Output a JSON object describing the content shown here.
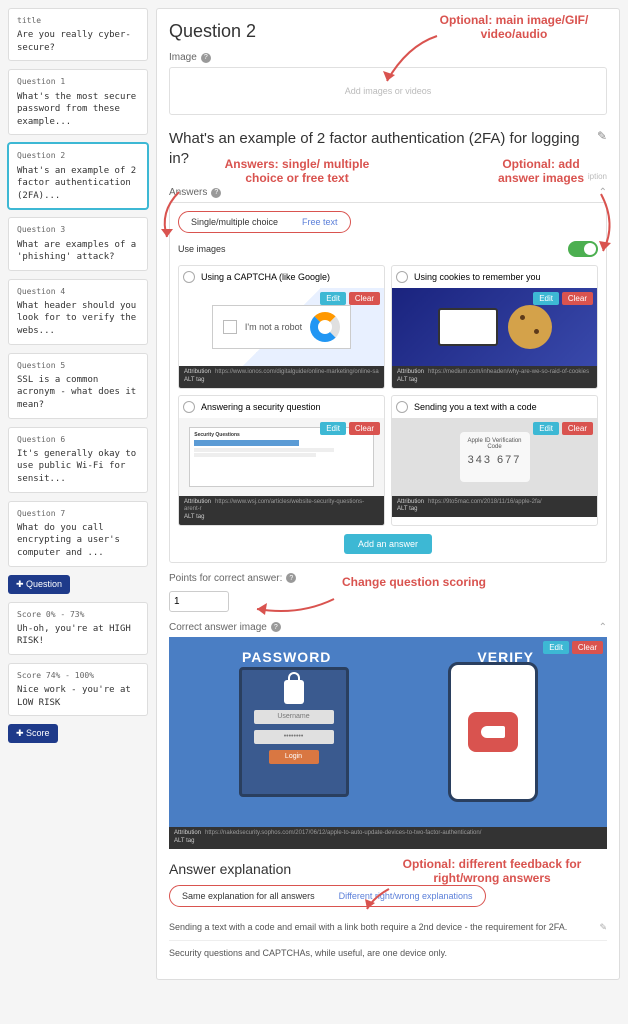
{
  "sidebar": {
    "title_card": {
      "label": "title",
      "text": "Are you really cyber-secure?"
    },
    "questions": [
      {
        "label": "Question 1",
        "text": "What's the most secure password from these example..."
      },
      {
        "label": "Question 2",
        "text": "What's an example of 2 factor authentication (2FA)..."
      },
      {
        "label": "Question 3",
        "text": "What are examples of a 'phishing' attack?"
      },
      {
        "label": "Question 4",
        "text": "What header should you look for to verify the webs..."
      },
      {
        "label": "Question 5",
        "text": "SSL is a common acronym - what does it mean?"
      },
      {
        "label": "Question 6",
        "text": "It's generally okay to use public Wi-Fi for sensit..."
      },
      {
        "label": "Question 7",
        "text": "What do you call encrypting a user's computer and ..."
      }
    ],
    "add_question_btn": "✚ Question",
    "scores": [
      {
        "label": "Score 0% - 73%",
        "text": "Uh-oh, you're at HIGH RISK!"
      },
      {
        "label": "Score 74% - 100%",
        "text": "Nice work - you're at LOW RISK"
      }
    ],
    "add_score_btn": "✚ Score"
  },
  "main": {
    "question_title": "Question 2",
    "image_label": "Image",
    "media_placeholder": "Add images or videos",
    "question_text": "What's an example of 2 factor authentication (2FA) for logging in?",
    "description_hint": "iption",
    "answers_label": "Answers",
    "tabs": {
      "choice": "Single/multiple choice",
      "free": "Free text"
    },
    "use_images_label": "Use images",
    "answers": [
      {
        "text": "Using a CAPTCHA (like Google)",
        "captcha_text": "I'm not a robot",
        "attribution": "https://www.ionos.com/digitalguide/online-marketing/online-sa",
        "alt_label": "ALT tag"
      },
      {
        "text": "Using cookies to remember you",
        "attribution": "https://medium.com/inheaden/why-are-we-so-raid-of-cookies",
        "alt_label": "ALT tag"
      },
      {
        "text": "Answering a security question",
        "panel_title": "Security Questions",
        "attribution": "https://www.wsj.com/articles/website-security-questions-arent-r",
        "alt_label": "ALT tag"
      },
      {
        "text": "Sending you a text with a code",
        "phone_title": "Apple ID Verification Code",
        "phone_code": "343 677",
        "attribution": "https://9to5mac.com/2018/11/16/apple-2fa/",
        "alt_label": "ALT tag"
      }
    ],
    "edit_btn": "Edit",
    "clear_btn": "Clear",
    "add_answer_btn": "Add an answer",
    "points_label": "Points for correct answer:",
    "points_value": "1",
    "correct_image_label": "Correct answer image",
    "password_label": "PASSWORD",
    "verify_label": "VERIFY",
    "username_field": "Username",
    "password_dots": "••••••••",
    "login_btn": "Login",
    "correct_attribution": "https://nakedsecurity.sophos.com/2017/06/12/apple-to-auto-update-devices-to-two-factor-authentication/",
    "correct_alt_label": "ALT tag",
    "exp_title": "Answer explanation",
    "exp_tabs": {
      "same": "Same explanation for all answers",
      "diff": "Different right/wrong explanations"
    },
    "exp_lines": [
      "Sending a text with a code and email with a link both require a 2nd device - the requirement for 2FA.",
      "Security questions and CAPTCHAs, while useful, are one device only."
    ]
  },
  "annotations": {
    "a1": "Optional: main image/GIF/\nvideo/audio",
    "a2": "Answers:\nsingle/ multiple choice\nor free text",
    "a3": "Optional: add\nanswer images",
    "a4": "Change question\nscoring",
    "a5": "Optional: different feedback\nfor right/wrong answers"
  }
}
